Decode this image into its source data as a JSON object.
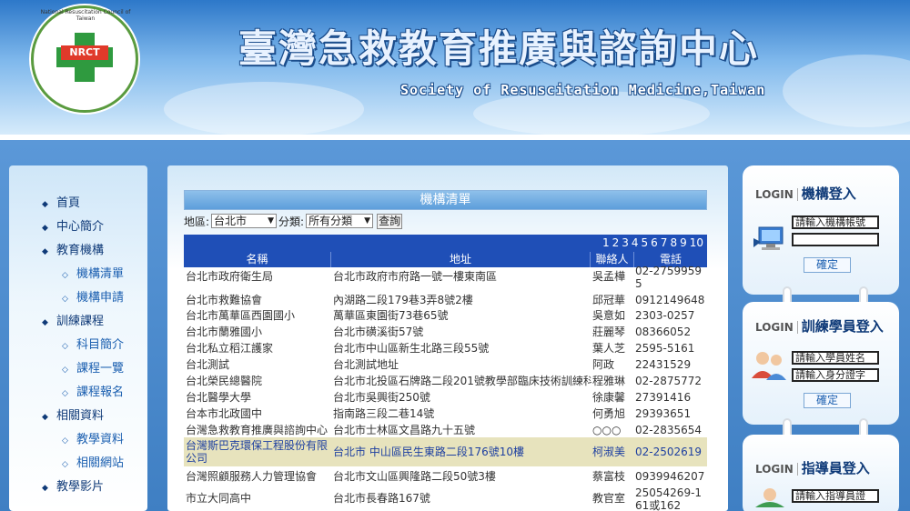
{
  "header": {
    "logo_ring_text": "National Resuscitation Council of Taiwan",
    "logo_badge": "NRCT",
    "title": "臺灣急救教育推廣與諮詢中心",
    "subtitle": "Society of Resuscitation Medicine,Taiwan"
  },
  "sidebar": {
    "items": [
      {
        "label": "首頁"
      },
      {
        "label": "中心簡介"
      },
      {
        "label": "教育機構"
      },
      {
        "label": "機構清單"
      },
      {
        "label": "機構申請"
      },
      {
        "label": "訓練課程"
      },
      {
        "label": "科目簡介"
      },
      {
        "label": "課程一覽"
      },
      {
        "label": "課程報名"
      },
      {
        "label": "相關資料"
      },
      {
        "label": "教學資料"
      },
      {
        "label": "相關網站"
      },
      {
        "label": "教學影片"
      }
    ]
  },
  "main": {
    "list_title": "機構清單",
    "filter": {
      "region_label": "地區:",
      "region_value": "台北市",
      "category_label": "分類:",
      "category_value": "所有分類",
      "query_button": "查詢"
    },
    "pages": [
      "1",
      "2",
      "3",
      "4",
      "5",
      "6",
      "7",
      "8",
      "9",
      "10"
    ],
    "columns": [
      "名稱",
      "地址",
      "聯絡人",
      "電話"
    ],
    "rows": [
      {
        "name": "台北市政府衛生局",
        "address": "台北市政府市府路一號一樓東南區",
        "contact": "吳孟樺",
        "phone": "02-2759959 5"
      },
      {
        "name": "台北市救難協會",
        "address": "內湖路二段179巷3弄8號2樓",
        "contact": "邱冠華",
        "phone": "0912149648"
      },
      {
        "name": "台北市萬華區西園國小",
        "address": "萬華區東園街73巷65號",
        "contact": "吳意如",
        "phone": "2303-0257"
      },
      {
        "name": "台北市蘭雅國小",
        "address": "台北市磺溪街57號",
        "contact": "莊麗琴",
        "phone": "08366052"
      },
      {
        "name": "台北私立稻江護家",
        "address": "台北市中山區新生北路三段55號",
        "contact": "葉人芝",
        "phone": "2595-5161"
      },
      {
        "name": "台北測試",
        "address": "台北測試地址",
        "contact": "阿政",
        "phone": "22431529"
      },
      {
        "name": "台北榮民總醫院",
        "address": "台北市北投區石牌路二段201號教學部臨床技術訓練科",
        "contact": "程雅琳",
        "phone": "02-2875772"
      },
      {
        "name": "台北醫學大學",
        "address": "台北市吳興街250號",
        "contact": "徐康馨",
        "phone": "27391416"
      },
      {
        "name": "台本市北政國中",
        "address": "指南路三段二巷14號",
        "contact": "何勇旭",
        "phone": "29393651"
      },
      {
        "name": "台灣急救教育推廣與諮詢中心",
        "address": "台北市士林區文昌路九十五號",
        "contact": "○○○",
        "phone": "02-2835654"
      },
      {
        "name": "台灣斯巴克環保工程股份有限公司",
        "address": "台北市 中山區民生東路二段176號10樓",
        "contact": "柯淑美",
        "phone": "02-2502619"
      },
      {
        "name": "台灣照顧服務人力管理協會",
        "address": "台北市文山區興隆路二段50號3樓",
        "contact": "蔡富枝",
        "phone": "0939946207"
      },
      {
        "name": "市立大同高中",
        "address": "台北市長春路167號",
        "contact": "教官室",
        "phone": "25054269-1 61或162"
      }
    ]
  },
  "login": {
    "org": {
      "tag": "LOGIN",
      "title": "機構登入",
      "account_placeholder": "請輸入機構帳號",
      "submit": "確定"
    },
    "student": {
      "tag": "LOGIN",
      "title": "訓練學員登入",
      "name_placeholder": "請輸入學員姓名",
      "id_placeholder": "請輸入身分證字",
      "submit": "確定"
    },
    "instructor": {
      "tag": "LOGIN",
      "title": "指導員登入",
      "placeholder": "請輸入指導員證"
    }
  },
  "colors": {
    "table_header": "#1f4fb7",
    "selected_row": "#e7e3bd",
    "nav_text": "#0f3a78"
  }
}
